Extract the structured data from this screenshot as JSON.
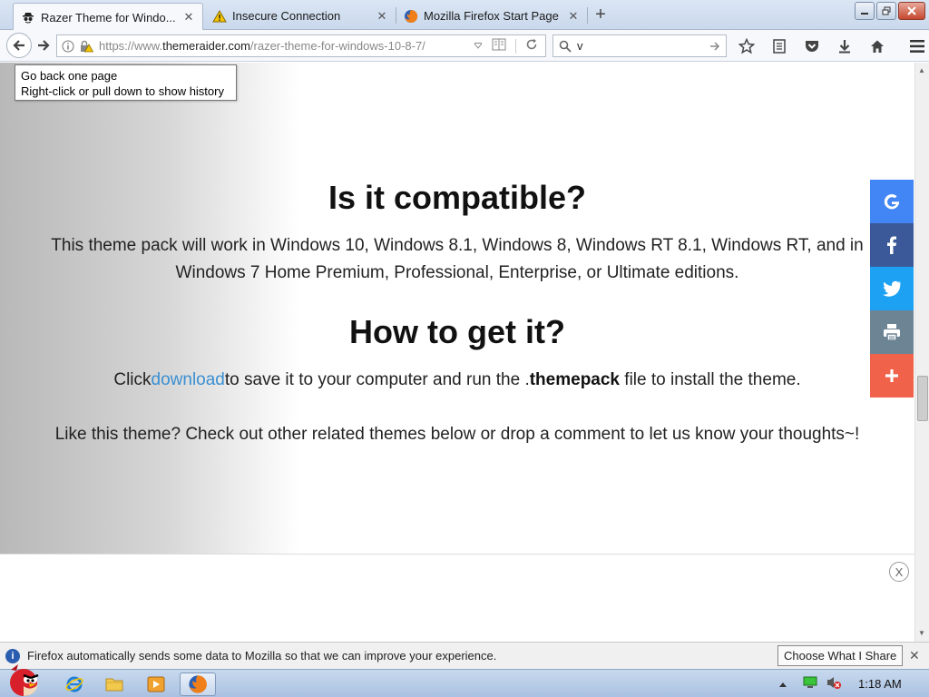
{
  "tabs": [
    {
      "label": "Razer Theme for Windo...",
      "icon": "spy-icon"
    },
    {
      "label": "Insecure Connection",
      "icon": "warning-icon"
    },
    {
      "label": "Mozilla Firefox Start Page",
      "icon": "firefox-icon"
    }
  ],
  "navbar": {
    "url_prefix": "https://www.",
    "url_domain": "themeraider.com",
    "url_path": "/razer-theme-for-windows-10-8-7/",
    "search_value": "v"
  },
  "tooltip": {
    "line1": "Go back one page",
    "line2": "Right-click or pull down to show history"
  },
  "content": {
    "heading1": "Is it compatible?",
    "para1_line1": "This theme pack will work in Windows 10, Windows 8.1, Windows 8, Windows RT 8.1, Windows RT, and in",
    "para1_line2": "Windows 7 Home Premium, Professional, Enterprise, or Ultimate editions.",
    "heading2": "How to get it?",
    "para2_before": "Click",
    "para2_link": "download",
    "para2_middle": "to save it to your computer and run the .",
    "para2_strong": "themepack",
    "para2_after": " file to install the theme.",
    "para3": "Like this theme? Check out other related themes below or drop a comment to let us know your thoughts~!",
    "ad_close": "X"
  },
  "share": [
    {
      "name": "google",
      "glyph": "G",
      "color": "#4285f4"
    },
    {
      "name": "facebook",
      "glyph": "f",
      "color": "#3b5998"
    },
    {
      "name": "twitter",
      "glyph": "t",
      "color": "#1da1f2"
    },
    {
      "name": "print",
      "glyph": "print",
      "color": "#6d8494"
    },
    {
      "name": "more",
      "glyph": "+",
      "color": "#f0624a"
    }
  ],
  "notification": {
    "text": "Firefox automatically sends some data to Mozilla so that we can improve your experience.",
    "button": "Choose What I Share"
  },
  "taskbar": {
    "clock": "1:18 AM"
  }
}
